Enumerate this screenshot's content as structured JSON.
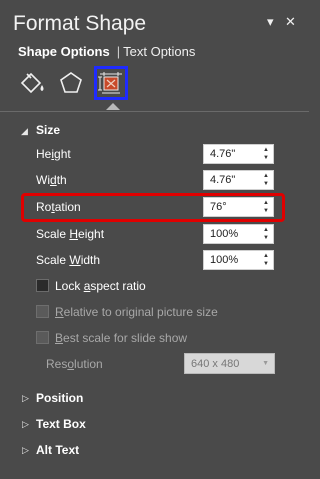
{
  "header": {
    "title": "Format Shape",
    "collapse_glyph": "▾",
    "close_glyph": "✕"
  },
  "tabs": [
    {
      "label": "Shape Options",
      "active": true
    },
    {
      "label": "Text Options",
      "active": false
    }
  ],
  "icons": [
    {
      "name": "fill-line-icon",
      "selected": false
    },
    {
      "name": "effects-icon",
      "selected": false
    },
    {
      "name": "size-properties-icon",
      "selected": true
    }
  ],
  "size_section": {
    "label": "Size",
    "expanded": true,
    "fields": [
      {
        "key": "height",
        "label": "Height",
        "value": "4.76\""
      },
      {
        "key": "width",
        "label": "Width",
        "value": "4.76\""
      },
      {
        "key": "rotation",
        "label": "Rotation",
        "value": "76°"
      },
      {
        "key": "scale_height",
        "label": "Scale Height",
        "value": "100%"
      },
      {
        "key": "scale_width",
        "label": "Scale Width",
        "value": "100%"
      }
    ],
    "checkboxes": [
      {
        "label": "Lock aspect ratio",
        "checked": true,
        "enabled": true
      },
      {
        "label": "Relative to original picture size",
        "checked": false,
        "enabled": false
      },
      {
        "label": "Best scale for slide show",
        "checked": false,
        "enabled": false
      }
    ],
    "resolution": {
      "label": "Resolution",
      "value": "640 x 480",
      "enabled": false
    }
  },
  "collapsed_sections": [
    {
      "label": "Position"
    },
    {
      "label": "Text Box"
    },
    {
      "label": "Alt Text"
    }
  ],
  "colors": {
    "panel_bg": "#4a4a4a",
    "highlight_red": "#e00000",
    "highlight_blue": "#1f2bff"
  }
}
